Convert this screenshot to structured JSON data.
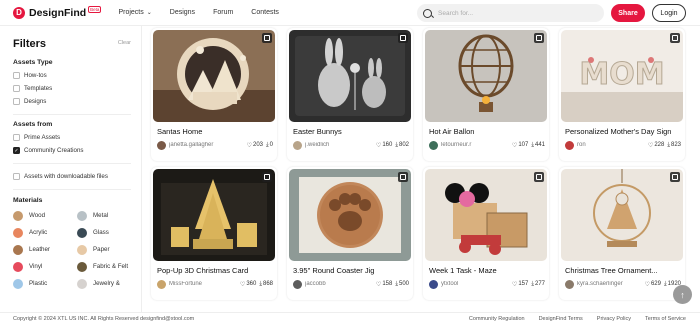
{
  "header": {
    "logo_letter": "D",
    "brand": "DesignFind",
    "beta_badge": "Beta",
    "nav": [
      {
        "label": "Projects",
        "has_dropdown": true
      },
      {
        "label": "Designs"
      },
      {
        "label": "Forum"
      },
      {
        "label": "Contests"
      }
    ],
    "search_placeholder": "Search for...",
    "share_label": "Share",
    "login_label": "Login",
    "accent_color": "#e5173f"
  },
  "sidebar": {
    "title": "Filters",
    "clear_label": "Clear",
    "asset_types_title": "Assets Type",
    "asset_types": [
      {
        "label": "How-tos",
        "checked": false
      },
      {
        "label": "Templates",
        "checked": false
      },
      {
        "label": "Designs",
        "checked": false
      }
    ],
    "assets_from_title": "Assets from",
    "assets_from": [
      {
        "label": "Prime Assets",
        "checked": false
      },
      {
        "label": "Community Creations",
        "checked": true
      }
    ],
    "downloadable_label": "Assets with downloadable files",
    "materials_title": "Materials",
    "materials": [
      {
        "label": "Wood",
        "color": "#c69a6d"
      },
      {
        "label": "Metal",
        "color": "#b8c1c6"
      },
      {
        "label": "Acrylic",
        "color": "#e8865e"
      },
      {
        "label": "Glass",
        "color": "#3a4a55"
      },
      {
        "label": "Leather",
        "color": "#a9774f"
      },
      {
        "label": "Paper",
        "color": "#e7c9a6"
      },
      {
        "label": "Vinyl",
        "color": "#e64a5c"
      },
      {
        "label": "Fabric & Felt",
        "color": "#6a5a3b"
      },
      {
        "label": "Plastic",
        "color": "#9fc7e8"
      },
      {
        "label": "Jewelry &",
        "color": "#d6d2cf"
      }
    ]
  },
  "cards": [
    {
      "title": "Santas Home",
      "author": "janetta.gallagher",
      "likes": "203",
      "downloads": "0",
      "avatar_color": "#7a5a48",
      "thumb": "santa"
    },
    {
      "title": "Easter Bunnys",
      "author": "j.weidlich",
      "likes": "160",
      "downloads": "802",
      "avatar_color": "#b8a48a",
      "thumb": "bunny"
    },
    {
      "title": "Hot Air Ballon",
      "author": "letourneur.r",
      "likes": "107",
      "downloads": "441",
      "avatar_color": "#3e6f5a",
      "thumb": "balloon"
    },
    {
      "title": "Personalized Mother's Day Sign",
      "author": "ron",
      "likes": "228",
      "downloads": "823",
      "avatar_color": "#c23b3b",
      "thumb": "mom"
    },
    {
      "title": "Pop-Up 3D Christmas Card",
      "author": "MissFortune",
      "likes": "360",
      "downloads": "868",
      "avatar_color": "#c9a46b",
      "thumb": "xmascard"
    },
    {
      "title": "3.95\" Round Coaster Jig",
      "author": "jaccobb",
      "likes": "158",
      "downloads": "500",
      "avatar_color": "#5d5d5d",
      "thumb": "coaster"
    },
    {
      "title": "Week 1 Task - Maze",
      "author": "ytxtool",
      "likes": "157",
      "downloads": "277",
      "avatar_color": "#3b4b8a",
      "thumb": "maze"
    },
    {
      "title": "Christmas Tree Ornament...",
      "author": "kyra.schaerlinger",
      "likes": "629",
      "downloads": "1920",
      "avatar_color": "#8a7a6a",
      "thumb": "ornament"
    }
  ],
  "footer": {
    "copyright": "Copyright © 2024 XTL US INC. All Rights Reserved designfind@xtool.com",
    "links": [
      "Community Regulation",
      "DesignFind Terms",
      "Privacy Policy",
      "Terms of Service"
    ]
  },
  "icons": {
    "like": "heart-icon",
    "download": "download-icon",
    "save": "bookmark-icon",
    "scroll_top": "arrow-up-icon"
  }
}
